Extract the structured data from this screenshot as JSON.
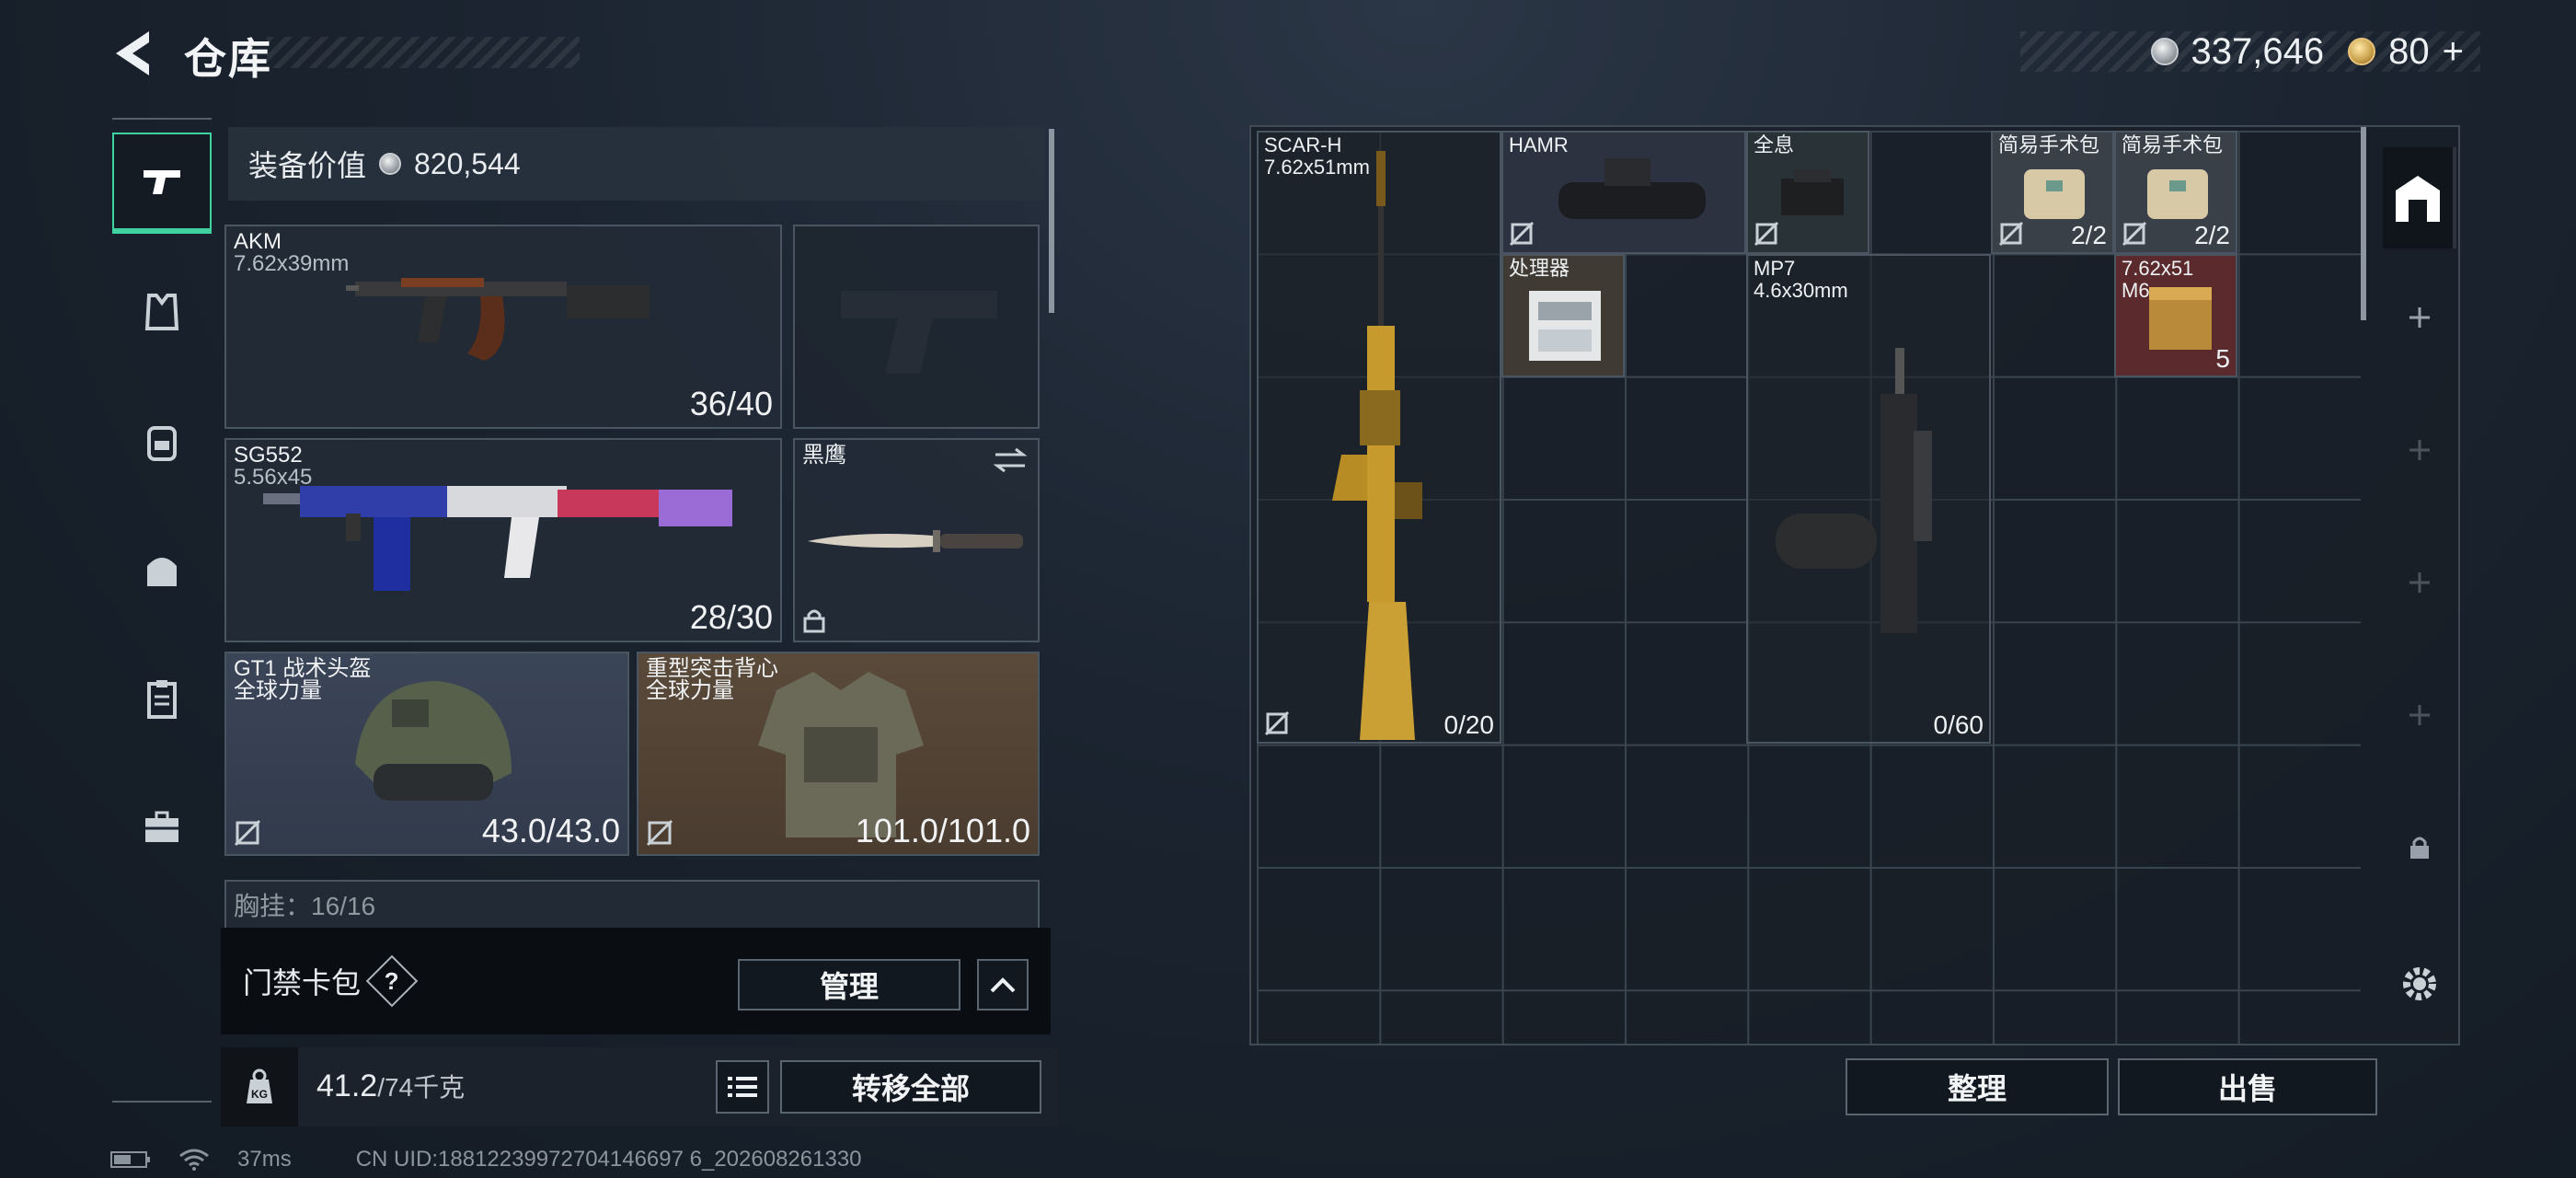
{
  "header": {
    "title": "仓库"
  },
  "currency": {
    "silver": "337,646",
    "gold": "80",
    "gold_plus": "+"
  },
  "nav": {
    "items": [
      "weapon-tab",
      "armor-tab",
      "backpack-tab",
      "bag-tab",
      "clipboard-tab",
      "case-tab"
    ]
  },
  "loadout": {
    "value_label": "装备价值",
    "value": "820,544",
    "primary": {
      "name": "AKM",
      "caliber": "7.62x39mm",
      "ammo": "36/40"
    },
    "secondary": {
      "name": "SG552",
      "caliber": "5.56x45",
      "ammo": "28/30"
    },
    "melee": {
      "name": "黑鹰"
    },
    "helmet": {
      "name": "GT1 战术头盔",
      "brand": "全球力量",
      "durability": "43.0/43.0"
    },
    "armor": {
      "name": "重型突击背心",
      "brand": "全球力量",
      "durability": "101.0/101.0"
    },
    "chest_rig": {
      "label": "胸挂",
      "capacity": "16/16"
    },
    "keycard": {
      "label": "门禁卡包",
      "help": "?",
      "manage": "管理"
    },
    "weight": {
      "current": "41.2",
      "max": "/74千克",
      "kg_label": "KG"
    },
    "transfer_all": "转移全部"
  },
  "stash": {
    "items": [
      {
        "name": "SCAR-H",
        "caliber": "7.62x51mm",
        "count": "0/20"
      },
      {
        "name": "HAMR"
      },
      {
        "name": "全息"
      },
      {
        "name": "简易手术包",
        "count": "2/2"
      },
      {
        "name": "简易手术包",
        "count": "2/2"
      },
      {
        "name": "处理器"
      },
      {
        "name": "MP7",
        "caliber": "4.6x30mm",
        "count": "0/60"
      },
      {
        "name": "7.62x51",
        "sub": "M6...",
        "count": "5"
      }
    ],
    "sort_label": "整理",
    "sell_label": "出售"
  },
  "status": {
    "ping": "37ms",
    "uid": "CN UID:18812239972704146697 6_202608261330"
  }
}
